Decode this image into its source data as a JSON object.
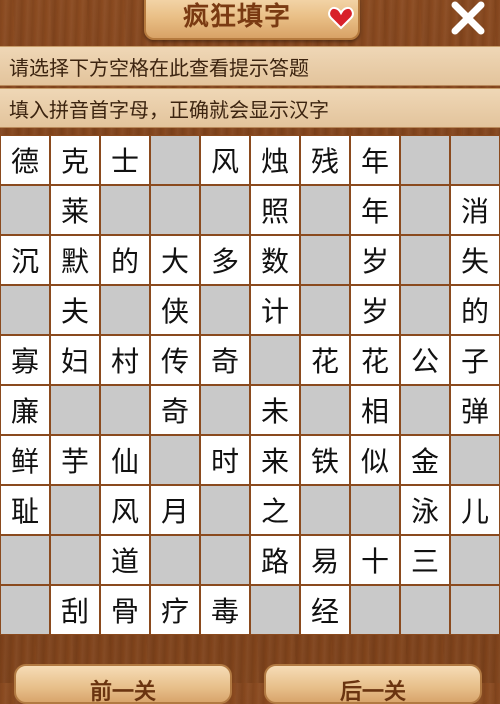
{
  "header": {
    "title": "疯狂填字",
    "heart_icon": "heart-icon",
    "close_icon": "close-icon"
  },
  "hints": {
    "line1": "请选择下方空格在此查看提示答题",
    "line2": "填入拼音首字母，正确就会显示汉字"
  },
  "grid": {
    "rows": [
      [
        "德",
        "克",
        "士",
        "",
        "风",
        "烛",
        "残",
        "年",
        "",
        ""
      ],
      [
        "",
        "莱",
        "",
        "",
        "",
        "照",
        "",
        "年",
        "",
        "消"
      ],
      [
        "沉",
        "默",
        "的",
        "大",
        "多",
        "数",
        "",
        "岁",
        "",
        "失"
      ],
      [
        "",
        "夫",
        "",
        "侠",
        "",
        "计",
        "",
        "岁",
        "",
        "的"
      ],
      [
        "寡",
        "妇",
        "村",
        "传",
        "奇",
        "",
        "花",
        "花",
        "公",
        "子"
      ],
      [
        "廉",
        "",
        "",
        "奇",
        "",
        "未",
        "",
        "相",
        "",
        "弹"
      ],
      [
        "鲜",
        "芋",
        "仙",
        "",
        "时",
        "来",
        "铁",
        "似",
        "金",
        ""
      ],
      [
        "耻",
        "",
        "风",
        "月",
        "",
        "之",
        "",
        "",
        "泳",
        "儿"
      ],
      [
        "",
        "",
        "道",
        "",
        "",
        "路",
        "易",
        "十",
        "三",
        ""
      ],
      [
        "",
        "刮",
        "骨",
        "疗",
        "毒",
        "",
        "经",
        "",
        "",
        ""
      ]
    ]
  },
  "buttons": {
    "prev": "前一关",
    "next": "后一关"
  },
  "colors": {
    "filled_cell": "#ffffff",
    "empty_cell": "#c9c9c9",
    "grid_line": "#8a4a1e",
    "hint_background": "#efd7b6"
  }
}
